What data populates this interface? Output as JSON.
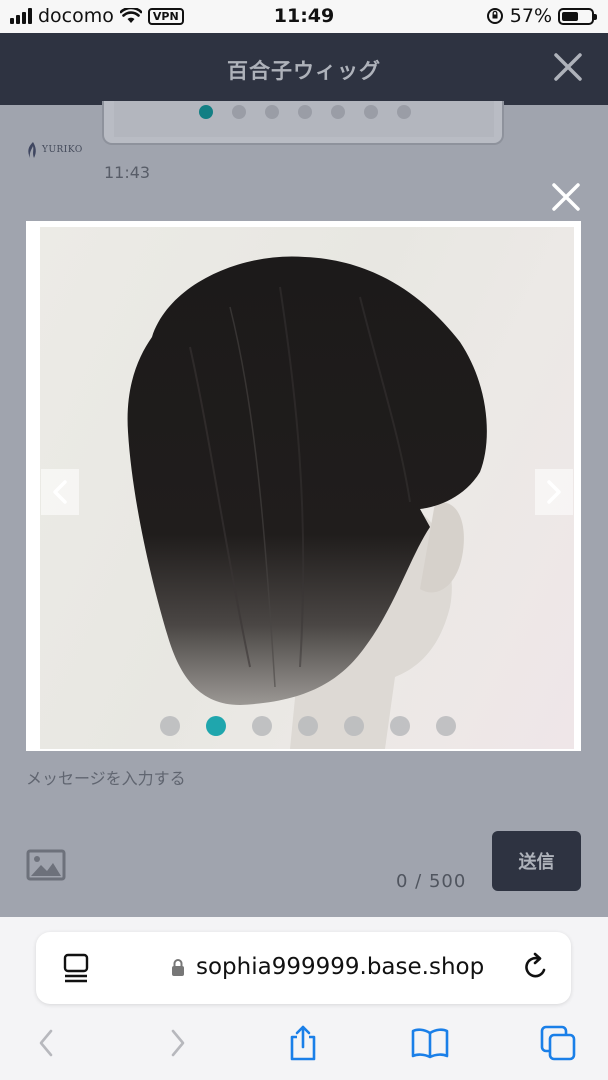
{
  "status_bar": {
    "carrier": "docomo",
    "vpn": "VPN",
    "time": "11:49",
    "battery": "57%",
    "battery_level": 0.57
  },
  "header": {
    "title": "百合子ウィッグ"
  },
  "chat": {
    "logo_text": "YURIKO",
    "timestamp": "11:43",
    "carousel_dot_count": 7,
    "carousel_active_index": 0
  },
  "lightbox": {
    "dot_count": 7,
    "active_index": 1
  },
  "composer": {
    "placeholder": "メッセージを入力する",
    "counter": "0 / 500",
    "send_label": "送信"
  },
  "browser": {
    "url": "sophia999999.base.shop"
  },
  "colors": {
    "header_bg": "#2e3341",
    "accent_dot": "#1fa6ad",
    "overlay": "#a0a4ae"
  }
}
